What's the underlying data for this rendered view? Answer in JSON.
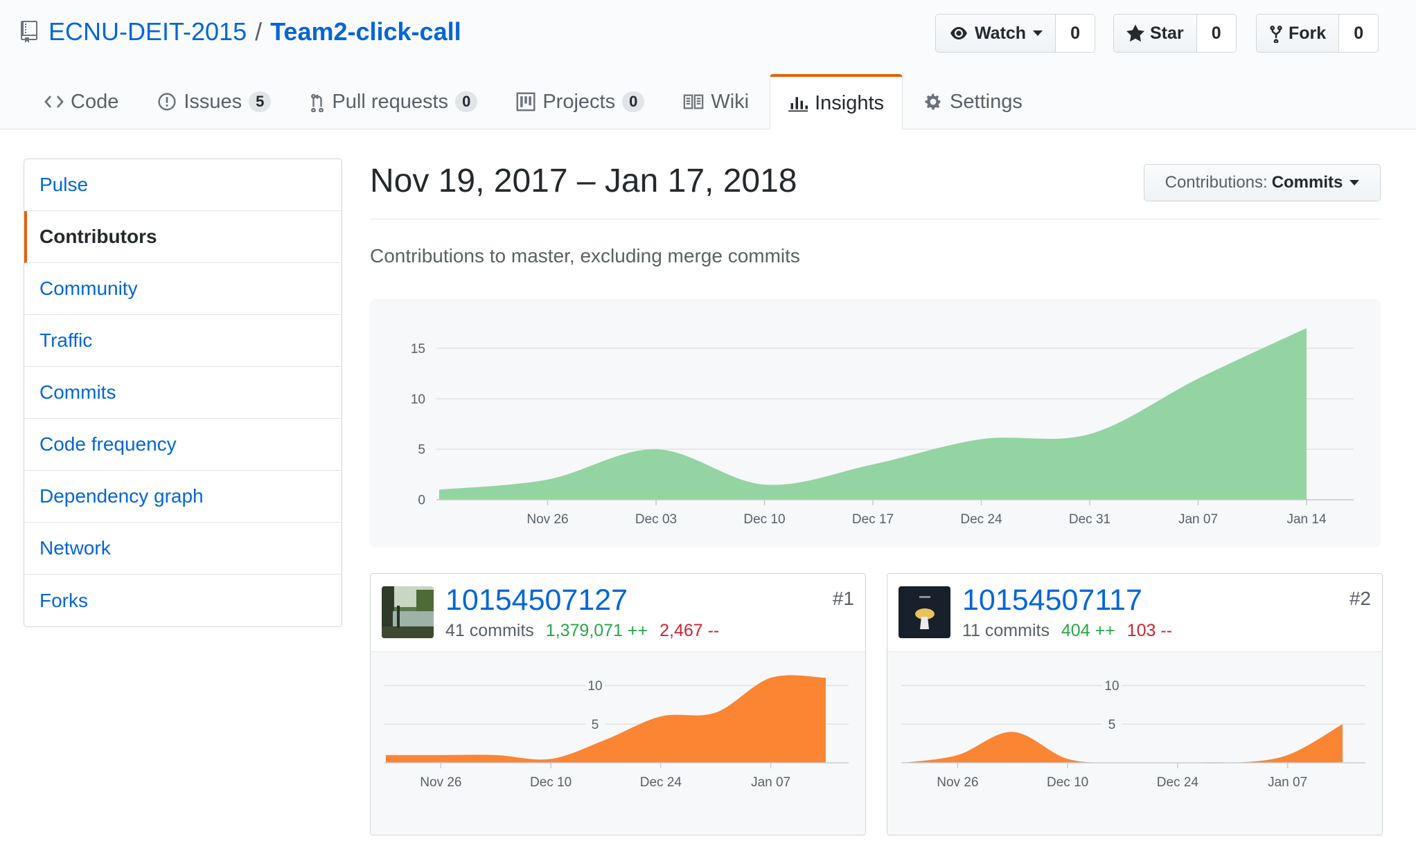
{
  "repo": {
    "owner": "ECNU-DEIT-2015",
    "separator": "/",
    "name": "Team2-click-call"
  },
  "actions": {
    "watch": {
      "label": "Watch",
      "count": "0"
    },
    "star": {
      "label": "Star",
      "count": "0"
    },
    "fork": {
      "label": "Fork",
      "count": "0"
    }
  },
  "tabs": [
    {
      "label": "Code",
      "icon": "code-icon"
    },
    {
      "label": "Issues",
      "count": "5",
      "icon": "issue-icon"
    },
    {
      "label": "Pull requests",
      "count": "0",
      "icon": "pull-request-icon"
    },
    {
      "label": "Projects",
      "count": "0",
      "icon": "project-icon"
    },
    {
      "label": "Wiki",
      "icon": "book-icon"
    },
    {
      "label": "Insights",
      "icon": "graph-icon",
      "selected": true
    },
    {
      "label": "Settings",
      "icon": "gear-icon"
    }
  ],
  "sidebar": {
    "items": [
      {
        "label": "Pulse"
      },
      {
        "label": "Contributors",
        "selected": true
      },
      {
        "label": "Community"
      },
      {
        "label": "Traffic"
      },
      {
        "label": "Commits"
      },
      {
        "label": "Code frequency"
      },
      {
        "label": "Dependency graph"
      },
      {
        "label": "Network"
      },
      {
        "label": "Forks"
      }
    ]
  },
  "main": {
    "date_range": "Nov 19, 2017 – Jan 17, 2018",
    "contributions_select": {
      "prefix": "Contributions:",
      "value": "Commits"
    },
    "subtitle": "Contributions to master, excluding merge commits"
  },
  "colors": {
    "accent": "#e36209",
    "link": "#0366d6",
    "main_area": "#94d3a2",
    "contributor_area": "#fb8532",
    "additions": "#28a745",
    "deletions": "#cb2431"
  },
  "chart_data": [
    {
      "type": "area",
      "title": "",
      "x": [
        "Nov 19",
        "Nov 26",
        "Dec 03",
        "Dec 10",
        "Dec 17",
        "Dec 24",
        "Dec 31",
        "Jan 07",
        "Jan 14"
      ],
      "x_ticks": [
        "Nov 26",
        "Dec 03",
        "Dec 10",
        "Dec 17",
        "Dec 24",
        "Dec 31",
        "Jan 07",
        "Jan 14"
      ],
      "y_ticks": [
        "0",
        "5",
        "10",
        "15"
      ],
      "series": [
        {
          "values": [
            1,
            2,
            5,
            1.5,
            3.5,
            6,
            6.5,
            12,
            17
          ]
        }
      ],
      "ylim": [
        0,
        17
      ],
      "grid": true
    },
    {
      "type": "area",
      "title": "",
      "x": [
        "Nov 19",
        "Nov 26",
        "Dec 03",
        "Dec 10",
        "Dec 17",
        "Dec 24",
        "Dec 31",
        "Jan 07",
        "Jan 14"
      ],
      "x_ticks": [
        "Nov 26",
        "Dec 10",
        "Dec 24",
        "Jan 07"
      ],
      "y_ticks": [
        "5",
        "10"
      ],
      "series": [
        {
          "values": [
            1,
            1,
            1,
            0.5,
            3,
            6,
            6.5,
            11,
            11
          ]
        }
      ],
      "ylim": [
        0,
        12
      ],
      "grid": true
    },
    {
      "type": "area",
      "title": "",
      "x": [
        "Nov 19",
        "Nov 26",
        "Dec 03",
        "Dec 10",
        "Dec 17",
        "Dec 24",
        "Dec 31",
        "Jan 07",
        "Jan 14"
      ],
      "x_ticks": [
        "Nov 26",
        "Dec 10",
        "Dec 24",
        "Jan 07"
      ],
      "y_ticks": [
        "5",
        "10"
      ],
      "series": [
        {
          "values": [
            0,
            1,
            4,
            0.5,
            0,
            0,
            0,
            1,
            5
          ]
        }
      ],
      "ylim": [
        0,
        12
      ],
      "grid": true
    }
  ],
  "contributors": [
    {
      "rank": "#1",
      "user": "10154507127",
      "commits": "41 commits",
      "additions": "1,379,071 ++",
      "deletions": "2,467 --",
      "avatar": "photo-avatar"
    },
    {
      "rank": "#2",
      "user": "10154507117",
      "commits": "11 commits",
      "additions": "404 ++",
      "deletions": "103 --",
      "avatar": "dark-avatar"
    }
  ]
}
